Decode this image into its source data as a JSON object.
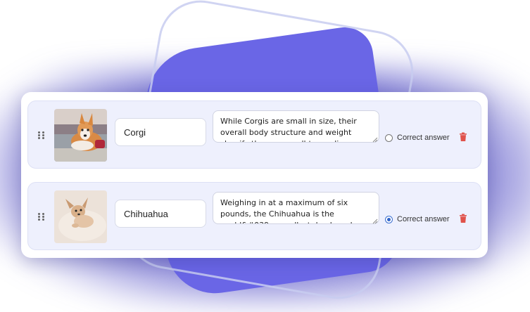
{
  "answers": [
    {
      "name": "Corgi",
      "description": "While Corgis are small in size, their overall body structure and weight classify them as small-to-medium-sized dogs, not the",
      "correct_label": "Correct answer",
      "is_correct": false,
      "image": "corgi-photo"
    },
    {
      "name": "Chihuahua",
      "description": "Weighing in at a maximum of six pounds, the Chihuahua is the world&#039;s smallest dog breed. They might be small",
      "correct_label": "Correct answer",
      "is_correct": true,
      "image": "chihuahua-photo"
    }
  ],
  "icons": {
    "drag": "drag-handle-icon",
    "delete": "trash-icon",
    "delete_color": "#e0524b"
  },
  "colors": {
    "accent_shape": "#6a66e6",
    "row_background": "#eef0fd",
    "radio_selected": "#2f63c9"
  }
}
